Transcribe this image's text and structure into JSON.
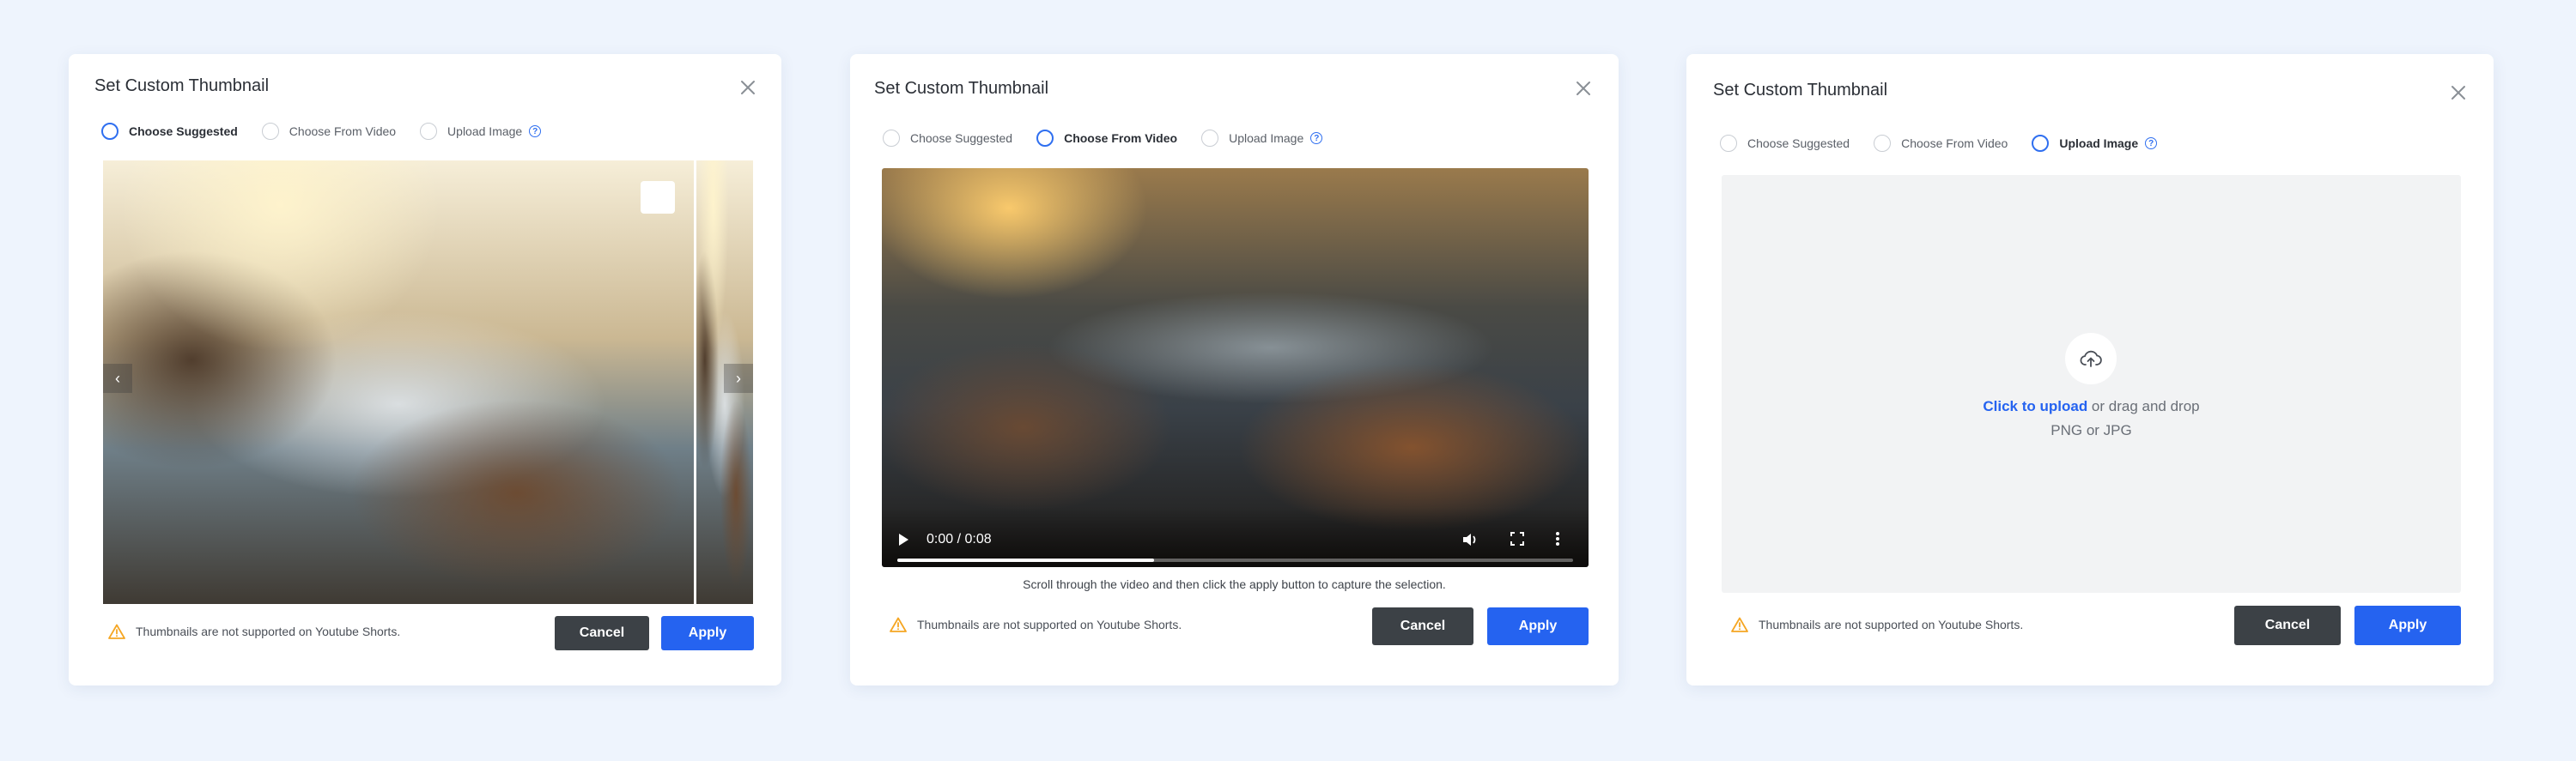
{
  "modal1": {
    "title": "Set Custom Thumbnail",
    "options": [
      "Choose Suggested",
      "Choose From Video",
      "Upload Image"
    ],
    "selected_option": "Choose Suggested",
    "help_glyph": "?",
    "prev_glyph": "‹",
    "next_glyph": "›",
    "warning": "Thumbnails are not supported on Youtube Shorts.",
    "cancel_label": "Cancel",
    "apply_label": "Apply"
  },
  "modal2": {
    "title": "Set Custom Thumbnail",
    "options": [
      "Choose Suggested",
      "Choose From Video",
      "Upload Image"
    ],
    "selected_option": "Choose From Video",
    "help_glyph": "?",
    "video_time": "0:00 / 0:08",
    "video_progress": 0.38,
    "caption": "Scroll through the video and then click the apply button to capture the selection.",
    "warning": "Thumbnails are not supported on Youtube Shorts.",
    "cancel_label": "Cancel",
    "apply_label": "Apply"
  },
  "modal3": {
    "title": "Set Custom Thumbnail",
    "options": [
      "Choose Suggested",
      "Choose From Video",
      "Upload Image"
    ],
    "selected_option": "Upload Image",
    "help_glyph": "?",
    "upload_link": "Click to upload",
    "upload_rest": " or drag and drop",
    "upload_formats": "PNG or JPG",
    "warning": "Thumbnails are not supported on Youtube Shorts.",
    "cancel_label": "Cancel",
    "apply_label": "Apply"
  },
  "colors": {
    "accent": "#2563f0",
    "cancel": "#3c4146",
    "warning": "#f5a623",
    "background": "#eef4fd"
  }
}
